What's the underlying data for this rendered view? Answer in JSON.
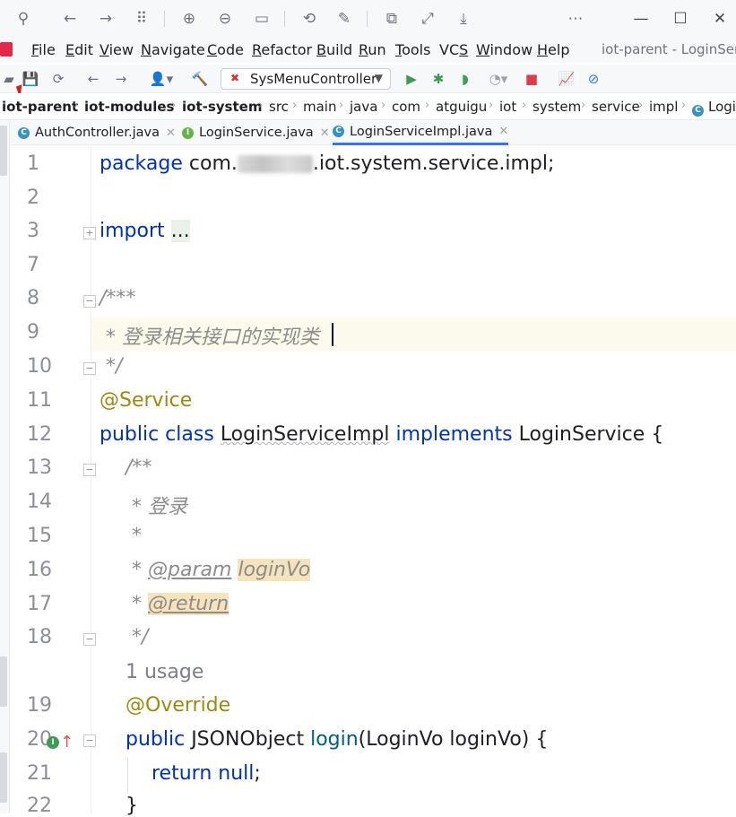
{
  "titlebar": {
    "icons": [
      "pin-icon",
      "back-arrow-icon",
      "forward-arrow-icon",
      "grid-icon",
      "zoom-in-icon",
      "zoom-out-icon",
      "fit-icon",
      "rotate-icon",
      "edit-icon",
      "share-icon",
      "expand-icon",
      "download-icon",
      "more-icon"
    ],
    "window_controls": [
      "minimize-icon",
      "maximize-icon",
      "close-icon"
    ]
  },
  "menu": {
    "items": [
      {
        "label": "File",
        "mnemonic": "F",
        "rest": "ile"
      },
      {
        "label": "Edit",
        "mnemonic": "E",
        "rest": "dit"
      },
      {
        "label": "View",
        "mnemonic": "V",
        "rest": "iew"
      },
      {
        "label": "Navigate",
        "mnemonic": "N",
        "rest": "avigate"
      },
      {
        "label": "Code",
        "mnemonic": "C",
        "rest": "ode"
      },
      {
        "label": "Refactor",
        "mnemonic": "R",
        "rest": "efactor"
      },
      {
        "label": "Build",
        "mnemonic": "B",
        "rest": "uild"
      },
      {
        "label": "Run",
        "mnemonic": "R",
        "rest": "un"
      },
      {
        "label": "Tools",
        "mnemonic": "T",
        "rest": "ools"
      },
      {
        "label": "VCS",
        "mnemonic": "S",
        "rest": "VC"
      },
      {
        "label": "Window",
        "mnemonic": "W",
        "rest": "indow"
      },
      {
        "label": "Help",
        "mnemonic": "H",
        "rest": "elp"
      }
    ],
    "window_title": "iot-parent - LoginServ"
  },
  "toolbar": {
    "run_config": "SysMenuController"
  },
  "breadcrumb": [
    "iot-parent",
    "iot-modules",
    "iot-system",
    "src",
    "main",
    "java",
    "com",
    "atguigu",
    "iot",
    "system",
    "service",
    "impl",
    "Logi"
  ],
  "tabs": [
    {
      "label": "AuthController.java",
      "badge": "C"
    },
    {
      "label": "LoginService.java",
      "badge": "I"
    },
    {
      "label": "LoginServiceImpl.java",
      "badge": "C",
      "active": true
    }
  ],
  "editor": {
    "line_numbers": [
      "1",
      "2",
      "3",
      "7",
      "8",
      "9",
      "10",
      "11",
      "12",
      "13",
      "14",
      "15",
      "16",
      "17",
      "18",
      "19",
      "20",
      "21",
      "22"
    ],
    "lines": {
      "l1_kw": "package",
      "l1_pre": " com.",
      "l1_post": ".iot.system.service.impl;",
      "l3_kw": "import",
      "l3_dots": "...",
      "l8": "/***",
      "l9": " * 登录相关接口的实现类",
      "l10": " */",
      "l11": "@Service",
      "l12_kw1": "public class",
      "l12_name": "LoginServiceImpl",
      "l12_kw2": "implements",
      "l12_iface": "LoginService {",
      "l13": "/**",
      "l14": " * 登录",
      "l15": " *",
      "l16_star": " * ",
      "l16_tag": "@param",
      "l16_param": "loginVo",
      "l17_star": " * ",
      "l17_tag": "@return",
      "l18": " */",
      "usage_hint": "1 usage",
      "l19": "@Override",
      "l20_kw": "public",
      "l20_type": " JSONObject ",
      "l20_fn": "login",
      "l20_args": "(LoginVo loginVo) {",
      "l21_kw": "return null",
      "l21_end": ";",
      "l22": "}"
    }
  },
  "colors": {
    "keyword": "#0033b3",
    "annotation": "#9e880d",
    "comment": "#8c8c8c",
    "method": "#00627a",
    "accent": "#3574f0"
  }
}
